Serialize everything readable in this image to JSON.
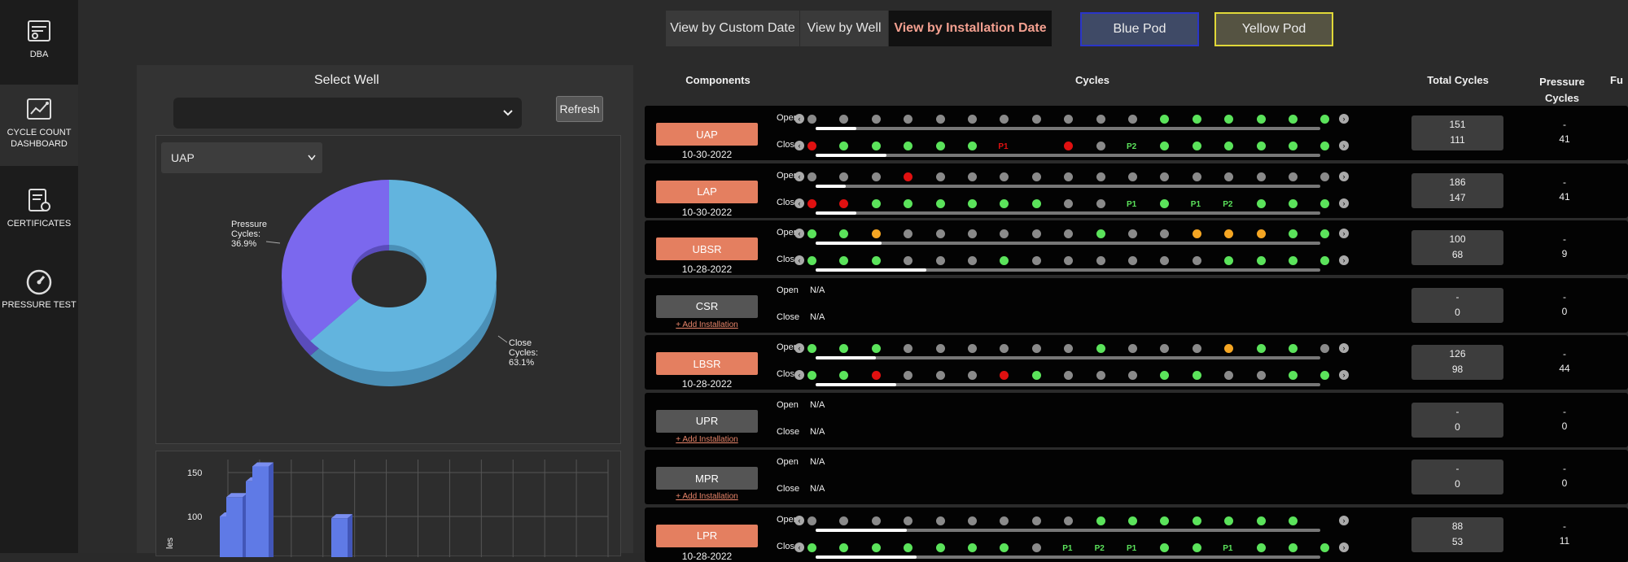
{
  "sidebar": {
    "items": [
      {
        "label": "DBA",
        "icon": "dba-icon"
      },
      {
        "label": "CYCLE COUNT DASHBOARD",
        "icon": "dashboard-chart-icon"
      },
      {
        "label": "CERTIFICATES",
        "icon": "certificate-icon"
      },
      {
        "label": "PRESSURE TEST",
        "icon": "gauge-icon"
      }
    ]
  },
  "views": [
    "View by Custom Date",
    "View by Well",
    "View by Installation Date"
  ],
  "pods": [
    "Blue Pod",
    "Yellow Pod"
  ],
  "left": {
    "title": "Select Well",
    "refresh": "Refresh",
    "component": "UAP"
  },
  "chart_data": [
    {
      "type": "pie",
      "slices": [
        {
          "label": "Pressure Cycles:",
          "value": 36.9,
          "display": "36.9%",
          "color": "#7b68ee"
        },
        {
          "label": "Close Cycles:",
          "value": 63.1,
          "display": "63.1%",
          "color": "#62b4de"
        }
      ]
    },
    {
      "type": "bar",
      "yticks": [
        150,
        100
      ],
      "ylabel_partial": "les",
      "groups": [
        {
          "values": [
            100,
            122
          ]
        },
        {
          "values": [
            140,
            157
          ]
        },
        {
          "values": [
            0,
            0
          ]
        },
        {
          "values": [
            0,
            0
          ]
        },
        {
          "values": [
            98,
            0
          ]
        }
      ]
    }
  ],
  "table": {
    "headers": {
      "components": "Components",
      "cycles": "Cycles",
      "total": "Total Cycles",
      "pressure": "Pressure Cycles",
      "cut": "Fu"
    },
    "open_label": "Open",
    "close_label": "Close",
    "na": "N/A",
    "add": "+ Add Installation",
    "rows": [
      {
        "name": "UAP",
        "date": "10-30-2022",
        "has": true,
        "open": "nnnnnnnnnnngggggg",
        "close": "rgggggg_rnngggggg",
        "closeTags": {
          "6": "P1",
          "10": "P2"
        },
        "openFill": 0.08,
        "closeFill": 0.14,
        "total": [
          "151",
          "111"
        ],
        "pc": [
          "-",
          "41"
        ]
      },
      {
        "name": "LAP",
        "date": "10-30-2022",
        "has": true,
        "open": "nnnrnnnnnnnnnnnnn",
        "close": "rrggggggnnggggggg",
        "closeTags": {
          "10": "P1",
          "12": "P1",
          "13": "P2"
        },
        "openFill": 0.06,
        "closeFill": 0.08,
        "total": [
          "186",
          "147"
        ],
        "pc": [
          "-",
          "41"
        ]
      },
      {
        "name": "UBSR",
        "date": "10-28-2022",
        "has": true,
        "open": "ggonnnnnngnnooogg",
        "close": "gggnnngnnnnnngggg",
        "closeTags": {},
        "openFill": 0.13,
        "closeFill": 0.22,
        "total": [
          "100",
          "68"
        ],
        "pc": [
          "-",
          "9"
        ]
      },
      {
        "name": "CSR",
        "date": "",
        "has": false,
        "total": [
          "-",
          "0"
        ],
        "pc": [
          "-",
          "0"
        ]
      },
      {
        "name": "LBSR",
        "date": "10-28-2022",
        "has": true,
        "open": "gggnnnnnngnnnoggn",
        "close": "ggrnnnrgnnnggnngg",
        "closeTags": {},
        "openFill": 0.12,
        "closeFill": 0.16,
        "total": [
          "126",
          "98"
        ],
        "pc": [
          "-",
          "44"
        ]
      },
      {
        "name": "UPR",
        "date": "",
        "has": false,
        "total": [
          "-",
          "0"
        ],
        "pc": [
          "-",
          "0"
        ]
      },
      {
        "name": "MPR",
        "date": "",
        "has": false,
        "total": [
          "-",
          "0"
        ],
        "pc": [
          "-",
          "0"
        ]
      },
      {
        "name": "LPR",
        "date": "10-28-2022",
        "has": true,
        "open": "nnnnnnnnnggggggg",
        "close": "gggggggnggggggggg",
        "closeTags": {
          "8": "P1",
          "9": "P2",
          "10": "P1",
          "13": "P1"
        },
        "openFill": 0.18,
        "closeFill": 0.2,
        "total": [
          "88",
          "53"
        ],
        "pc": [
          "-",
          "11"
        ]
      }
    ]
  }
}
